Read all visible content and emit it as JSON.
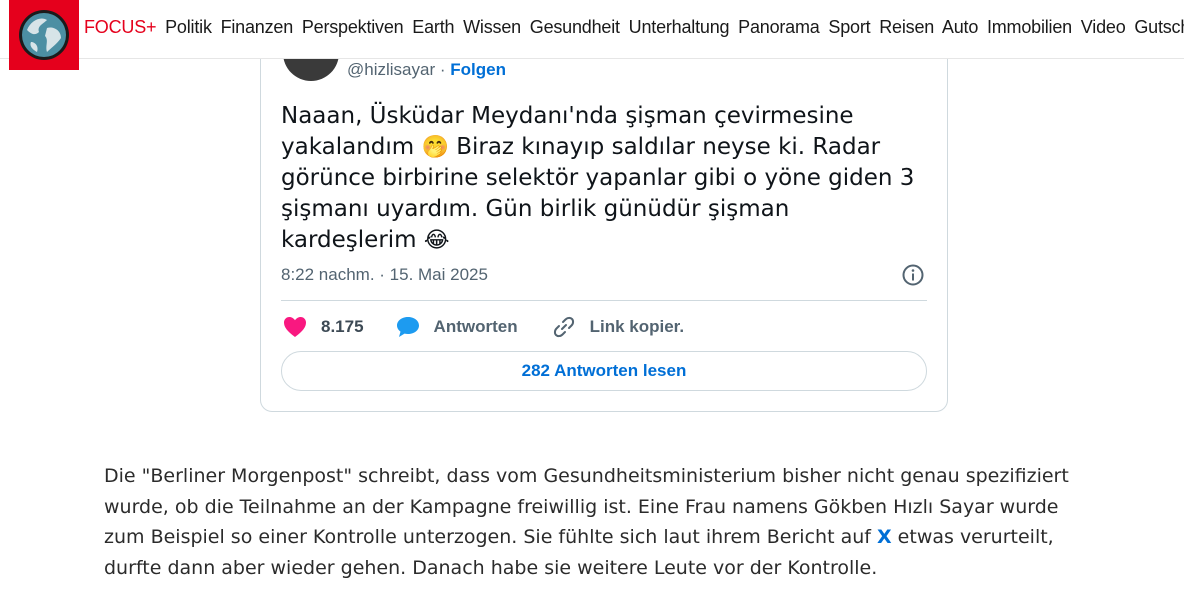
{
  "nav": {
    "logo_icon": "globe-icon",
    "brand": "FOCUS+",
    "items": [
      "Politik",
      "Finanzen",
      "Perspektiven",
      "Earth",
      "Wissen",
      "Gesundheit",
      "Unterhaltung",
      "Panorama",
      "Sport",
      "Reisen",
      "Auto",
      "Immobilien",
      "Video",
      "Gutscheine"
    ]
  },
  "tweet": {
    "handle": "@hizlisayar",
    "separator": "·",
    "follow": "Folgen",
    "text_parts": [
      "Naaan, Üsküdar Meydanı'nda şişman çevirmesine yakalandım ",
      "🤭",
      " Biraz kınayıp saldılar neyse ki. Radar görünce birbirine selektör yapanlar gibi o yöne giden 3 şişmanı uyardım. Gün birlik günüdür şişman kardeşlerim ",
      "😂"
    ],
    "timestamp": "8:22 nachm. · 15. Mai 2025",
    "likes": "8.175",
    "reply_label": "Antworten",
    "copy_label": "Link kopier.",
    "read_replies": "282 Antworten lesen"
  },
  "article": {
    "before_link": "Die \"Berliner Morgenpost\" schreibt, dass vom Gesundheitsministerium bisher nicht genau spezifiziert wurde, ob die Teilnahme an der Kampagne freiwillig ist. Eine Frau namens Gökben Hızlı Sayar wurde zum Beispiel so einer Kontrolle unterzogen. Sie fühlte sich laut ihrem Bericht auf ",
    "link": "X",
    "after_link": " etwas verurteilt, durfte dann aber wieder gehen. Danach habe sie weitere Leute vor der Kontrolle."
  },
  "colors": {
    "brand_red": "#e5001c",
    "link_blue": "#006fd6",
    "heart_pink": "#f91880",
    "reply_blue": "#1d9bf0"
  }
}
